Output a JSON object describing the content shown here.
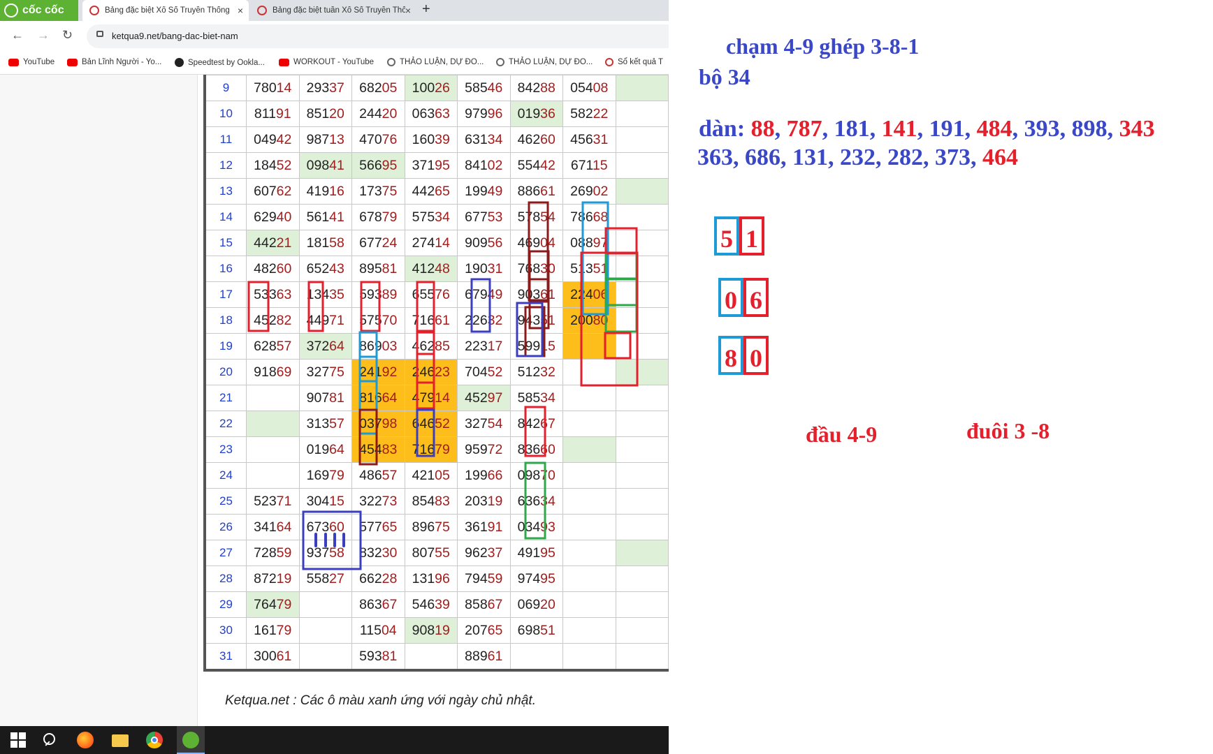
{
  "browser": {
    "brand": "cốc cốc",
    "tabs": [
      {
        "title": "Bảng đặc biệt Xổ Số Truyền Thống"
      },
      {
        "title": "Bảng đặc biệt tuần Xổ Số Truyền Thống"
      }
    ],
    "new_tab": "+",
    "close": "×",
    "url": "ketqua9.net/bang-dac-biet-nam",
    "bookmarks": [
      {
        "label": "YouTube",
        "icon": "youtube-icon"
      },
      {
        "label": "Bản Lĩnh Người - Yo...",
        "icon": "youtube-icon"
      },
      {
        "label": "Speedtest by Ookla...",
        "icon": "speedtest-icon"
      },
      {
        "label": "WORKOUT - YouTube",
        "icon": "youtube-icon"
      },
      {
        "label": "THẢO LUẬN, DỰ ĐO...",
        "icon": "globe-icon"
      },
      {
        "label": "THẢO LUẬN, DỰ ĐO...",
        "icon": "globe-icon"
      },
      {
        "label": "Sổ kết quả T",
        "icon": "ketqua-icon"
      }
    ]
  },
  "table": {
    "rows": [
      {
        "day": "9",
        "cells": [
          "78014",
          "29337",
          "68205",
          "10026",
          "58546",
          "84288",
          "05408",
          ""
        ]
      },
      {
        "day": "10",
        "cells": [
          "81191",
          "85120",
          "24420",
          "06363",
          "97996",
          "01936",
          "58222",
          ""
        ]
      },
      {
        "day": "11",
        "cells": [
          "04942",
          "98713",
          "47076",
          "16039",
          "63134",
          "46260",
          "45631",
          ""
        ]
      },
      {
        "day": "12",
        "cells": [
          "18452",
          "09841",
          "56695",
          "37195",
          "84102",
          "55442",
          "67115",
          ""
        ]
      },
      {
        "day": "13",
        "cells": [
          "60762",
          "41916",
          "17375",
          "44265",
          "19949",
          "88661",
          "26902",
          ""
        ]
      },
      {
        "day": "14",
        "cells": [
          "62940",
          "56141",
          "67879",
          "57534",
          "67753",
          "57854",
          "78668",
          ""
        ]
      },
      {
        "day": "15",
        "cells": [
          "44221",
          "18158",
          "67724",
          "27414",
          "90956",
          "46904",
          "08897",
          ""
        ]
      },
      {
        "day": "16",
        "cells": [
          "48260",
          "65243",
          "89581",
          "41248",
          "19031",
          "76830",
          "51351",
          ""
        ]
      },
      {
        "day": "17",
        "cells": [
          "53363",
          "13435",
          "59389",
          "65576",
          "67949",
          "90361",
          "22406",
          ""
        ]
      },
      {
        "day": "18",
        "cells": [
          "45282",
          "44971",
          "57570",
          "71661",
          "22632",
          "94351",
          "20080",
          ""
        ]
      },
      {
        "day": "19",
        "cells": [
          "62857",
          "37264",
          "86903",
          "46285",
          "22317",
          "59915",
          "",
          ""
        ]
      },
      {
        "day": "20",
        "cells": [
          "91869",
          "32775",
          "24192",
          "24623",
          "70452",
          "51232",
          "",
          ""
        ]
      },
      {
        "day": "21",
        "cells": [
          "",
          "90781",
          "81664",
          "47914",
          "45297",
          "58534",
          "",
          ""
        ]
      },
      {
        "day": "22",
        "cells": [
          "",
          "31357",
          "03798",
          "64652",
          "32754",
          "84267",
          "",
          ""
        ]
      },
      {
        "day": "23",
        "cells": [
          "",
          "01964",
          "45483",
          "71679",
          "95972",
          "83660",
          "",
          ""
        ]
      },
      {
        "day": "24",
        "cells": [
          "",
          "16979",
          "48657",
          "42105",
          "19966",
          "09870",
          "",
          ""
        ]
      },
      {
        "day": "25",
        "cells": [
          "52371",
          "30415",
          "32273",
          "85483",
          "20319",
          "63634",
          "",
          ""
        ]
      },
      {
        "day": "26",
        "cells": [
          "34164",
          "67360",
          "57765",
          "89675",
          "36191",
          "03493",
          "",
          ""
        ]
      },
      {
        "day": "27",
        "cells": [
          "72859",
          "93758",
          "83230",
          "80755",
          "96237",
          "49195",
          "",
          ""
        ]
      },
      {
        "day": "28",
        "cells": [
          "87219",
          "55827",
          "66228",
          "13196",
          "79459",
          "97495",
          "",
          ""
        ]
      },
      {
        "day": "29",
        "cells": [
          "76479",
          "",
          "86367",
          "54639",
          "85867",
          "06920",
          "",
          ""
        ]
      },
      {
        "day": "30",
        "cells": [
          "16179",
          "",
          "11504",
          "90819",
          "20765",
          "69851",
          "",
          ""
        ]
      },
      {
        "day": "31",
        "cells": [
          "30061",
          "",
          "59381",
          "",
          "88961",
          "",
          "",
          ""
        ]
      }
    ],
    "highlight_color": "#a31d1d",
    "sunday_color": "#dff0d8",
    "marked_color": "#fdbd1b"
  },
  "footer_note": "Ketqua.net : Các ô màu xanh ứng với ngày chủ nhật.",
  "annotations": {
    "cham_line": "chạm 4-9 ghép 3-8-1",
    "bo_line": "bộ 34",
    "dan_label": "dàn:",
    "dan_line1": [
      {
        "v": "88",
        "c": "red"
      },
      {
        "v": "787",
        "c": "red"
      },
      {
        "v": "181",
        "c": "blue"
      },
      {
        "v": "141",
        "c": "red"
      },
      {
        "v": "191",
        "c": "blue"
      },
      {
        "v": "484",
        "c": "red"
      },
      {
        "v": "393",
        "c": "blue"
      },
      {
        "v": "898",
        "c": "blue"
      },
      {
        "v": "343",
        "c": "red"
      }
    ],
    "dan_line2": [
      {
        "v": "363",
        "c": "blue"
      },
      {
        "v": "686",
        "c": "blue"
      },
      {
        "v": "131",
        "c": "blue"
      },
      {
        "v": "232",
        "c": "blue"
      },
      {
        "v": "282",
        "c": "blue"
      },
      {
        "v": "373",
        "c": "blue"
      },
      {
        "v": "464",
        "c": "red"
      }
    ],
    "pairs": [
      {
        "a": "5",
        "b": "1"
      },
      {
        "a": "0",
        "b": "6"
      },
      {
        "a": "8",
        "b": "0"
      }
    ],
    "dau": "đầu 4-9",
    "duoi": "đuôi 3 -8",
    "colors": {
      "blue": "#3a48c7",
      "red": "#e3202c",
      "box_blue": "#1e9ad6"
    }
  }
}
